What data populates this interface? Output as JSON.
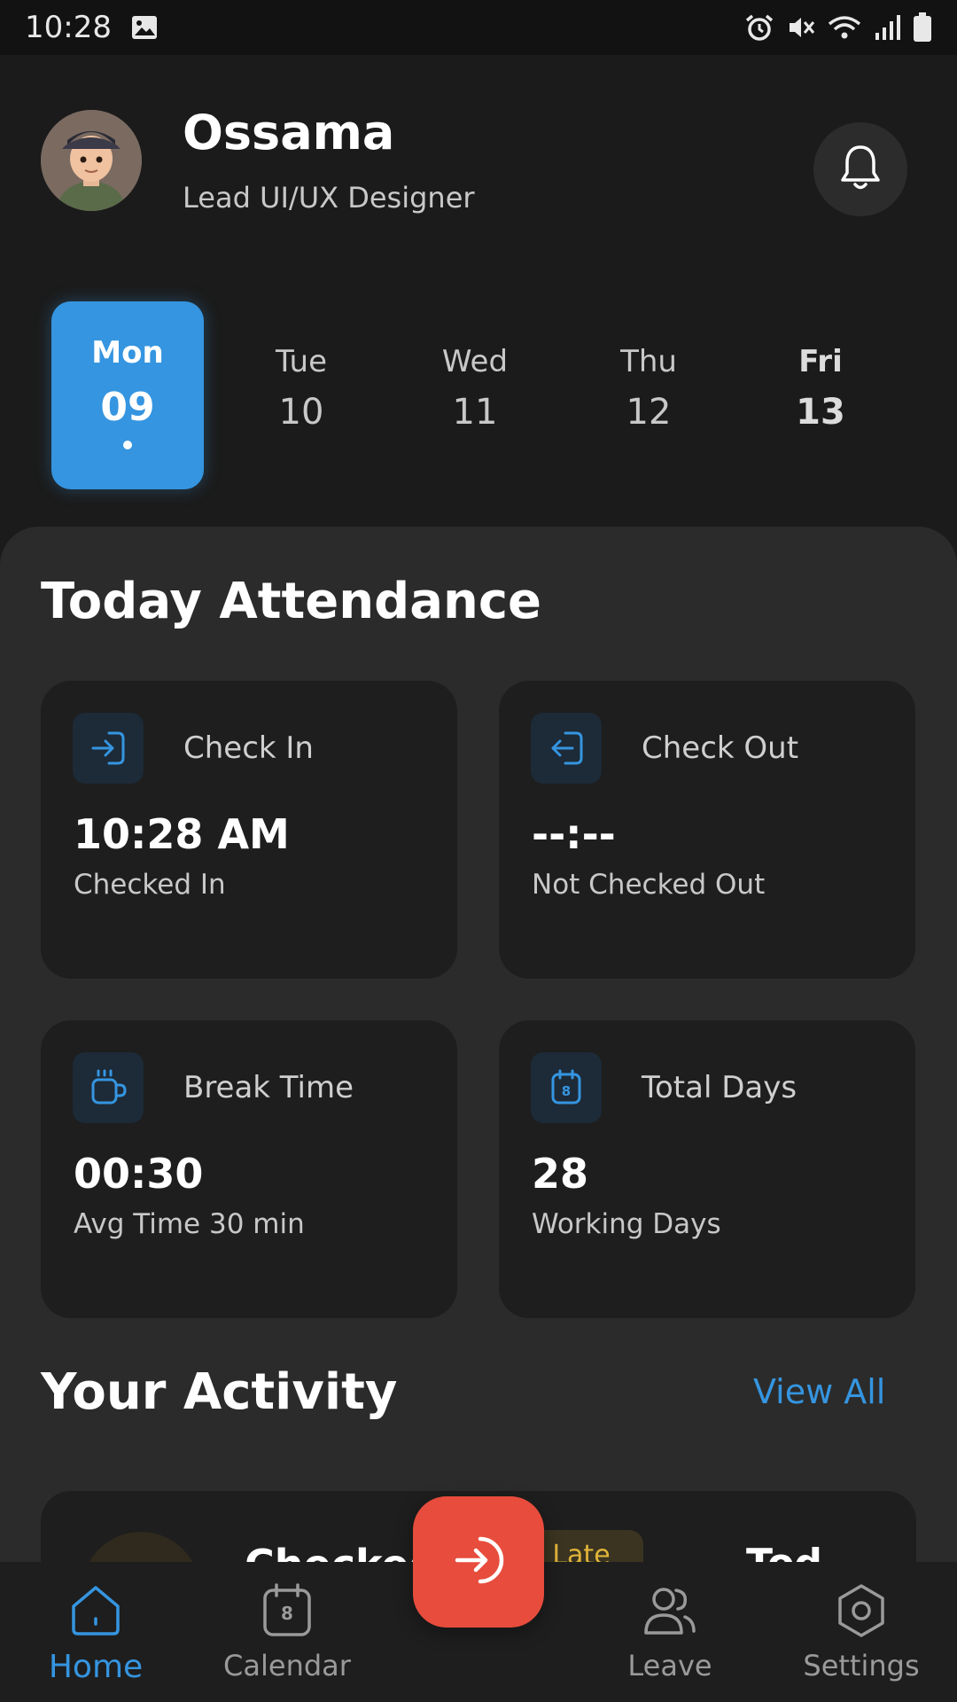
{
  "status_bar": {
    "time": "10:28",
    "icons": [
      "image-icon",
      "alarm-icon",
      "mute-icon",
      "wifi-icon",
      "signal-icon",
      "battery-icon"
    ]
  },
  "user": {
    "name": "Ossama",
    "role": "Lead UI/UX Designer"
  },
  "days": [
    {
      "name": "Mon",
      "num": "09",
      "active": true
    },
    {
      "name": "Tue",
      "num": "10"
    },
    {
      "name": "Wed",
      "num": "11"
    },
    {
      "name": "Thu",
      "num": "12"
    },
    {
      "name": "Fri",
      "num": "13"
    }
  ],
  "attendance": {
    "title": "Today Attendance",
    "cards": [
      {
        "label": "Check In",
        "value": "10:28 AM",
        "sub": "Checked In",
        "icon": "login-icon"
      },
      {
        "label": "Check Out",
        "value": "--:--",
        "sub": "Not Checked Out",
        "icon": "logout-icon"
      },
      {
        "label": "Break Time",
        "value": "00:30",
        "sub": "Avg Time 30 min",
        "icon": "coffee-cup-icon"
      },
      {
        "label": "Total Days",
        "value": "28",
        "sub": "Working Days",
        "icon": "calendar-icon"
      }
    ]
  },
  "activity": {
    "title": "Your Activity",
    "view_all": "View All",
    "item": {
      "title": "Checked",
      "badge": "Late",
      "time": "Tod"
    }
  },
  "nav": {
    "home": "Home",
    "calendar": "Calendar",
    "calendar_day": "8",
    "leave": "Leave",
    "settings": "Settings"
  },
  "colors": {
    "accent": "#3595e0",
    "fab": "#e74c3c",
    "background": "#1b1b1b",
    "panel": "#2b2b2b",
    "card": "#1e1e1e"
  }
}
